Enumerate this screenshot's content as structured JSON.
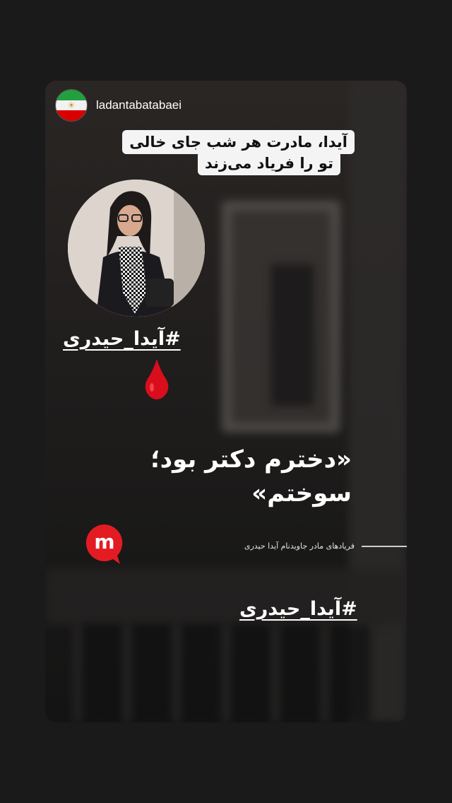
{
  "story": {
    "username": "ladantabatabaei",
    "avatar_icon": "iran-lion-sun-flag",
    "quote_lines": [
      "آیدا، مادرت هر شب جای خالی",
      "تو را فریاد می‌زند"
    ],
    "hashtag_top": "#آیدا_حیدری",
    "headline_line1": "«دخترم دکتر بود؛",
    "headline_line2": "سوختم»",
    "subline": "فریادهای مادر جاویدنام آیدا حیدری",
    "hashtag_bottom": "#آیدا_حیدری",
    "drop_icon": "blood-drop",
    "logo_icon": "m-logo",
    "colors": {
      "background": "#1a1a1a",
      "drop": "#d90d1c",
      "logo": "#e31b23",
      "quote_bg": "#f4f4f4",
      "text": "#ffffff"
    }
  }
}
